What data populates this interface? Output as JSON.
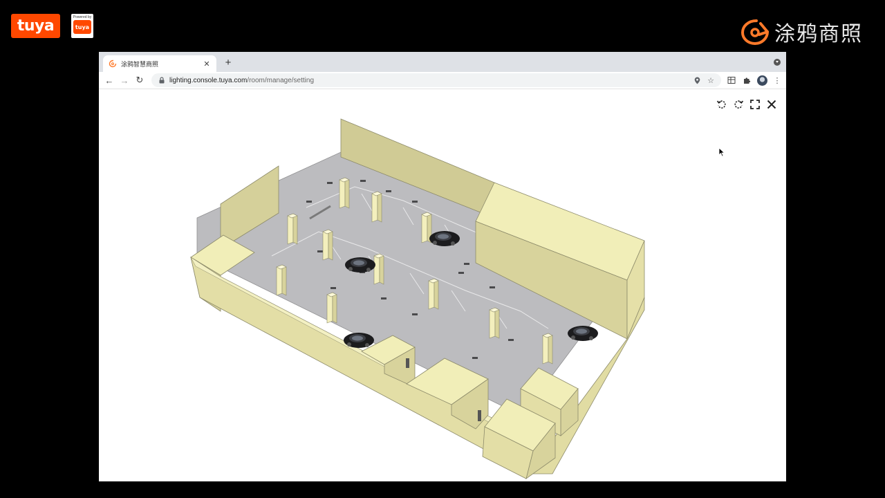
{
  "overlay": {
    "logo_left": "tuya",
    "powered_by": "Powered by",
    "powered_badge": "tuya",
    "brand_right": "涂鸦商照",
    "accent": "#ff4800"
  },
  "browser": {
    "tab": {
      "title": "涂鸦智慧商照",
      "favicon": "tuya-favicon-icon",
      "close_glyph": "✕"
    },
    "new_tab_glyph": "+",
    "toolbar": {
      "back_glyph": "←",
      "forward_glyph": "→",
      "reload_glyph": "↻",
      "url_host": "lighting.console.tuya.com",
      "url_path": "/room/manage/setting",
      "star_glyph": "☆",
      "menu_glyph": "⋮"
    }
  },
  "viewer": {
    "controls": [
      "rotate-left-icon",
      "rotate-right-icon",
      "fullscreen-icon",
      "close-icon"
    ],
    "scene": "parking-garage-3d-model",
    "wall_color": "#f1eeb8",
    "floor_color": "#b9b9bc"
  }
}
